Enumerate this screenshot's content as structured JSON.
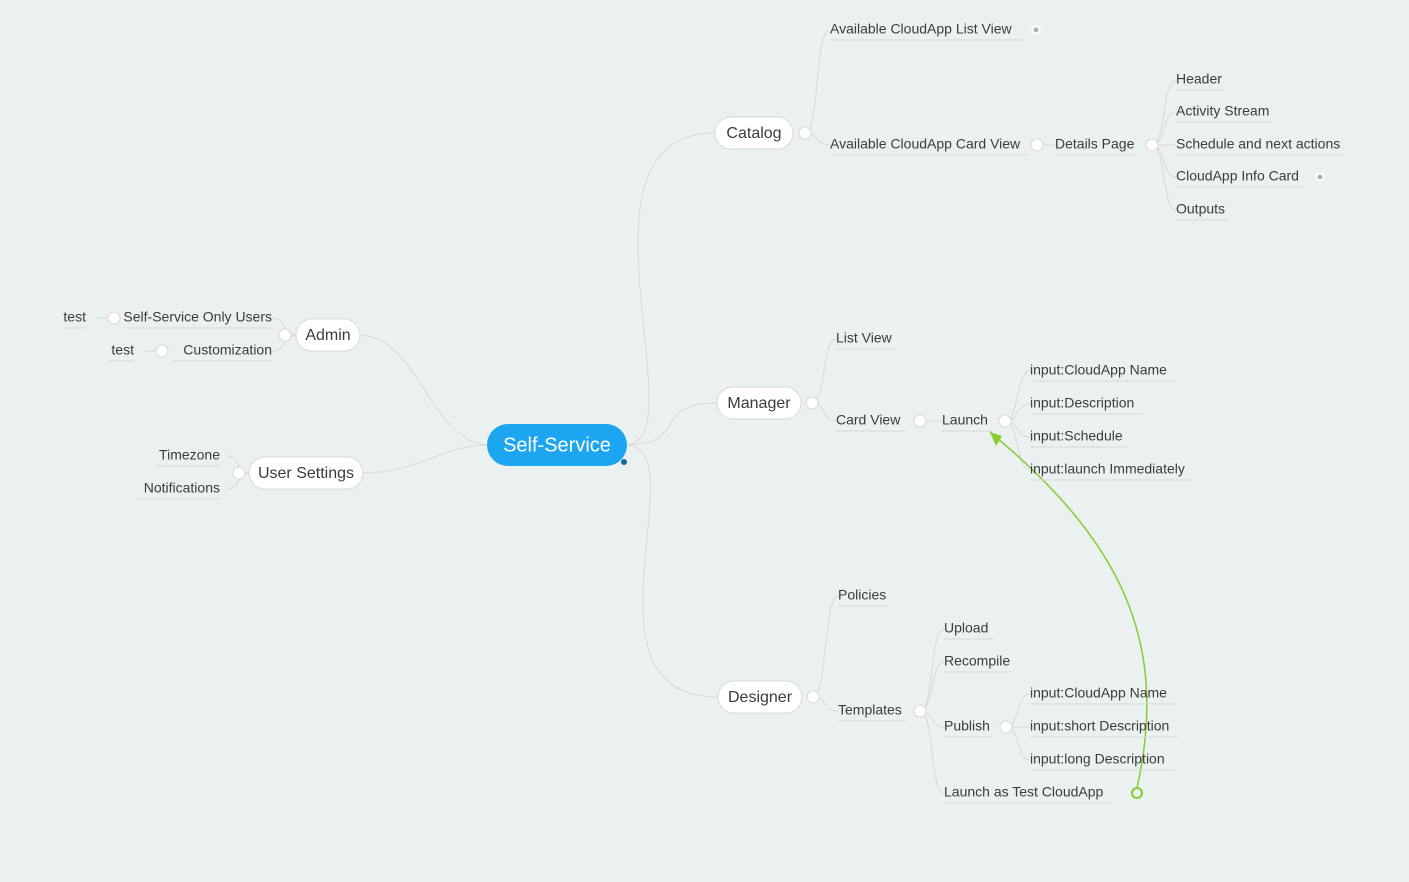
{
  "root": "Self-Service",
  "left": {
    "admin": {
      "label": "Admin",
      "children": {
        "users": {
          "label": "Self-Service Only Users",
          "child": "test"
        },
        "custom": {
          "label": "Customization",
          "child": "test"
        }
      }
    },
    "userSettings": {
      "label": "User Settings",
      "children": {
        "tz": "Timezone",
        "notif": "Notifications"
      }
    }
  },
  "right": {
    "catalog": {
      "label": "Catalog",
      "children": {
        "listView": "Available CloudApp List View",
        "cardView": {
          "label": "Available CloudApp Card View",
          "child": {
            "label": "Details Page",
            "children": {
              "header": "Header",
              "activity": "Activity Stream",
              "schedule": "Schedule and next actions",
              "infoCard": "CloudApp Info Card",
              "outputs": "Outputs"
            }
          }
        }
      }
    },
    "manager": {
      "label": "Manager",
      "children": {
        "listView": "List View",
        "cardView": {
          "label": "Card View",
          "child": {
            "label": "Launch",
            "children": {
              "name": "input:CloudApp Name",
              "desc": "input:Description",
              "sched": "input:Schedule",
              "launch": "input:launch Immediately"
            }
          }
        }
      }
    },
    "designer": {
      "label": "Designer",
      "children": {
        "policies": "Policies",
        "templates": {
          "label": "Templates",
          "children": {
            "upload": "Upload",
            "recompile": "Recompile",
            "publish": {
              "label": "Publish",
              "children": {
                "name": "input:CloudApp Name",
                "short": "input:short Description",
                "long": "input:long Description"
              }
            },
            "launchTest": "Launch as Test CloudApp"
          }
        }
      }
    }
  }
}
